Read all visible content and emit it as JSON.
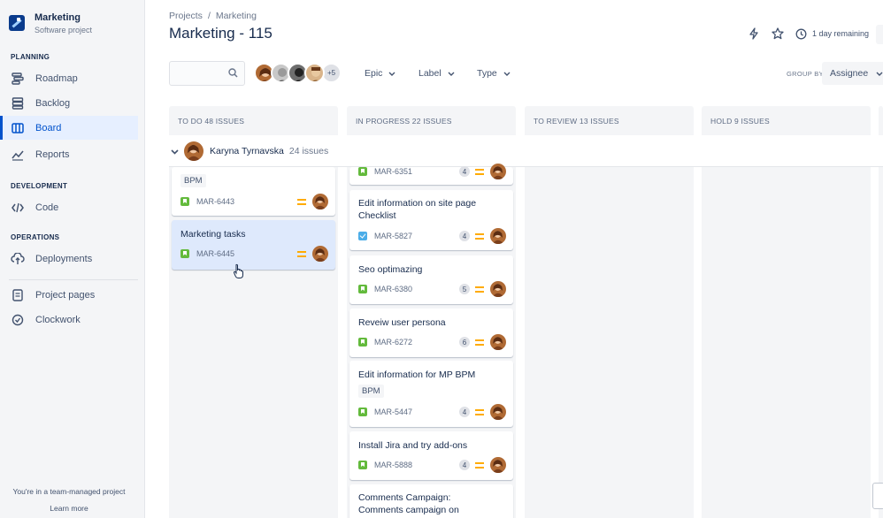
{
  "sidebar": {
    "project_name": "Marketing",
    "project_type": "Software project",
    "sections": {
      "planning": "PLANNING",
      "development": "DEVELOPMENT",
      "operations": "OPERATIONS"
    },
    "items": {
      "roadmap": "Roadmap",
      "backlog": "Backlog",
      "board": "Board",
      "reports": "Reports",
      "code": "Code",
      "deployments": "Deployments",
      "project_pages": "Project pages",
      "clockwork": "Clockwork"
    },
    "team_note": "You're in a team-managed project",
    "learn_more": "Learn more"
  },
  "header": {
    "breadcrumb": [
      "Projects",
      "/",
      "Marketing"
    ],
    "title": "Marketing - 115",
    "remaining": "1 day remaining"
  },
  "filters": {
    "search_placeholder": "",
    "more_avatars": "+5",
    "epic": "Epic",
    "label": "Label",
    "type": "Type",
    "group_by_label": "GROUP BY",
    "group_by_value": "Assignee"
  },
  "columns": [
    {
      "title": "TO DO 48 ISSUES"
    },
    {
      "title": "IN PROGRESS 22 ISSUES"
    },
    {
      "title": "TO REVIEW 13 ISSUES"
    },
    {
      "title": "HOLD 9 ISSUES"
    }
  ],
  "swimlane": {
    "name": "Karyna Tyrnavska",
    "count": "24 issues"
  },
  "todo_cards": [
    {
      "title": "",
      "epic": "BPM",
      "key": "MAR-6443"
    },
    {
      "title": "Marketing tasks",
      "key": "MAR-6445"
    }
  ],
  "progress_cards": [
    {
      "key": "MAR-6351",
      "estimate": "4"
    },
    {
      "title1": "Edit information on site page",
      "title2": "Checklist",
      "key": "MAR-5827",
      "estimate": "4"
    },
    {
      "title1": "Seo optimazing",
      "key": "MAR-6380",
      "estimate": "5"
    },
    {
      "title1": "Reveiw user persona",
      "key": "MAR-6272",
      "estimate": "6"
    },
    {
      "title1": "Edit information for MP BPM",
      "epic": "BPM",
      "key": "MAR-5447",
      "estimate": "4"
    },
    {
      "title1": "Install Jira and try add-ons",
      "key": "MAR-5888",
      "estimate": "4"
    },
    {
      "title1": "Comments Campaign:",
      "title2": "Comments campaign on"
    }
  ],
  "colors": {
    "accent": "#0052cc",
    "story": "#63ba3c",
    "task": "#4bade8",
    "priority": "#ffab00"
  }
}
